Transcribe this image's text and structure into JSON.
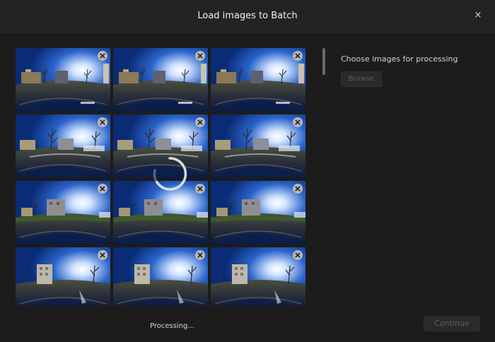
{
  "dialog": {
    "title": "Load images to Batch",
    "close_label": "×"
  },
  "panel": {
    "choose_label": "Choose images for processing",
    "browse_label": "Browse"
  },
  "footer": {
    "status_text": "Processing...",
    "continue_label": "Continue"
  },
  "colors": {
    "background": "#1c1c1c",
    "title_bar": "#232323",
    "disabled_text": "#5e5e5e",
    "sky": "#1a4fb3",
    "remove_badge": "#b7b7b7"
  },
  "thumbnails": [
    {
      "scene": "courtyard-buildings"
    },
    {
      "scene": "courtyard-buildings"
    },
    {
      "scene": "courtyard-buildings"
    },
    {
      "scene": "path-bare-trees"
    },
    {
      "scene": "path-bare-trees"
    },
    {
      "scene": "path-bare-trees"
    },
    {
      "scene": "lawn-tall-building"
    },
    {
      "scene": "lawn-tall-building"
    },
    {
      "scene": "lawn-tall-building"
    },
    {
      "scene": "plaza-tower-sun"
    },
    {
      "scene": "plaza-tower-sun"
    },
    {
      "scene": "plaza-tower-sun"
    }
  ]
}
